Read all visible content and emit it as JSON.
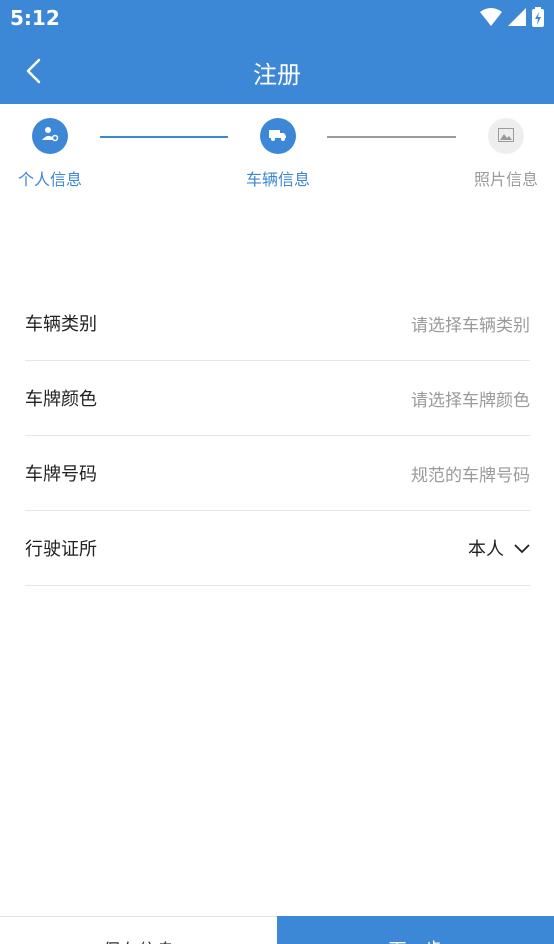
{
  "status_bar": {
    "time": "5:12",
    "icons": [
      "wifi-icon",
      "signal-icon",
      "battery-icon"
    ]
  },
  "app_bar": {
    "title": "注册",
    "back_icon": "chevron-left-icon"
  },
  "steps": [
    {
      "label": "个人信息",
      "icon": "person-icon",
      "state": "done"
    },
    {
      "label": "车辆信息",
      "icon": "truck-icon",
      "state": "active"
    },
    {
      "label": "照片信息",
      "icon": "image-icon",
      "state": "inactive"
    }
  ],
  "form": {
    "rows": [
      {
        "label": "车辆类别",
        "placeholder": "请选择车辆类别"
      },
      {
        "label": "车牌颜色",
        "placeholder": "请选择车牌颜色"
      },
      {
        "label": "车牌号码",
        "placeholder": "规范的车牌号码"
      },
      {
        "label": "行驶证所",
        "value": "本人",
        "icon": "chevron-down-icon"
      }
    ]
  },
  "bottom": {
    "left_label": "保存信息",
    "right_label": "下一步"
  },
  "colors": {
    "primary": "#3d87d7",
    "inactive": "#9a9a9a",
    "divider": "#e6e6e6"
  }
}
